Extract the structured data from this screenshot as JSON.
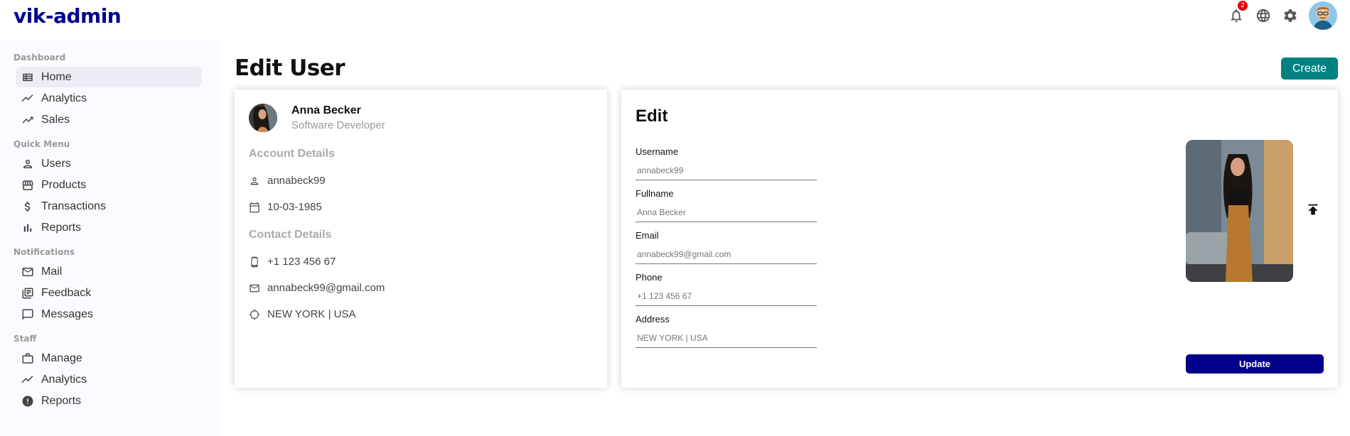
{
  "app": {
    "logo": "vik-admin"
  },
  "topbar": {
    "notification_count": "2",
    "icons": [
      "notifications-icon",
      "language-icon",
      "settings-icon"
    ]
  },
  "sidebar": {
    "sections": [
      {
        "title": "Dashboard",
        "items": [
          {
            "label": "Home",
            "icon": "home-icon",
            "active": true
          },
          {
            "label": "Analytics",
            "icon": "timeline-icon"
          },
          {
            "label": "Sales",
            "icon": "trending-up-icon"
          }
        ]
      },
      {
        "title": "Quick Menu",
        "items": [
          {
            "label": "Users",
            "icon": "user-icon"
          },
          {
            "label": "Products",
            "icon": "storefront-icon"
          },
          {
            "label": "Transactions",
            "icon": "dollar-icon"
          },
          {
            "label": "Reports",
            "icon": "bar-chart-icon"
          }
        ]
      },
      {
        "title": "Notifications",
        "items": [
          {
            "label": "Mail",
            "icon": "mail-icon"
          },
          {
            "label": "Feedback",
            "icon": "feedback-icon"
          },
          {
            "label": "Messages",
            "icon": "chat-icon"
          }
        ]
      },
      {
        "title": "Staff",
        "items": [
          {
            "label": "Manage",
            "icon": "briefcase-icon"
          },
          {
            "label": "Analytics",
            "icon": "timeline-icon"
          },
          {
            "label": "Reports",
            "icon": "report-icon"
          }
        ]
      }
    ]
  },
  "page": {
    "title": "Edit User",
    "create_label": "Create"
  },
  "user_show": {
    "name": "Anna Becker",
    "job": "Software Developer",
    "account_title": "Account Details",
    "username": "annabeck99",
    "birthday": "10-03-1985",
    "contact_title": "Contact Details",
    "phone": "+1 123 456 67",
    "email": "annabeck99@gmail.com",
    "address": "NEW YORK | USA"
  },
  "user_edit": {
    "title": "Edit",
    "fields": {
      "username": {
        "label": "Username",
        "placeholder": "annabeck99"
      },
      "fullname": {
        "label": "Fullname",
        "placeholder": "Anna Becker"
      },
      "email": {
        "label": "Email",
        "placeholder": "annabeck99@gmail.com"
      },
      "phone": {
        "label": "Phone",
        "placeholder": "+1 123 456 67"
      },
      "address": {
        "label": "Address",
        "placeholder": "NEW YORK | USA"
      }
    },
    "update_label": "Update"
  },
  "colors": {
    "logo": "#00008b",
    "create_button": "#008080",
    "update_button": "#00008b",
    "sidebar_bg": "#fbfbff",
    "active_item": "#ededf6"
  }
}
